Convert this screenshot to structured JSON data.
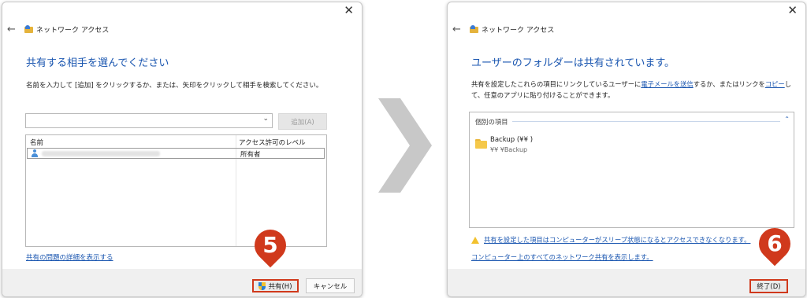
{
  "dialog1": {
    "title": "ネットワーク アクセス",
    "heading": "共有する相手を選んでください",
    "instruction": "名前を入力して [追加] をクリックするか、または、矢印をクリックして相手を検索してください。",
    "combo_value": "",
    "add_button": "追加(A)",
    "columns": [
      "名前",
      "アクセス許可のレベル"
    ],
    "rows": [
      {
        "permission": "所有者"
      }
    ],
    "help_link": "共有の問題の詳細を表示する",
    "share_button": "共有(H)",
    "cancel_button": "キャンセル",
    "step_marker": "5"
  },
  "dialog2": {
    "title": "ネットワーク アクセス",
    "heading": "ユーザーのフォルダーは共有されています。",
    "desc_part1": "共有を設定したこれらの項目にリンクしているユーザーに",
    "email_link": "電子メールを送信",
    "desc_part2": "するか、またはリンクを",
    "copy_link": "コピー",
    "desc_part3": "して、任意のアプリに貼り付けることができます。",
    "items_header": "個別の項目",
    "item_name": "Backup (¥¥         )",
    "item_path": "¥¥            ¥Backup",
    "warning_link": "共有を設定した項目はコンピューターがスリープ状態になるとアクセスできなくなります。",
    "all_shares_link": "コンピューター上のすべてのネットワーク共有を表示します。",
    "finish_button": "終了(D)",
    "step_marker": "6"
  },
  "colors": {
    "accent": "#1a56b0",
    "marker": "#d0391c",
    "chevron": "#c8c8c8"
  },
  "icons": [
    "close-icon",
    "back-arrow-icon",
    "network-folder-icon",
    "user-icon",
    "shield-icon",
    "folder-icon",
    "warning-icon",
    "chevron-right-icon"
  ]
}
